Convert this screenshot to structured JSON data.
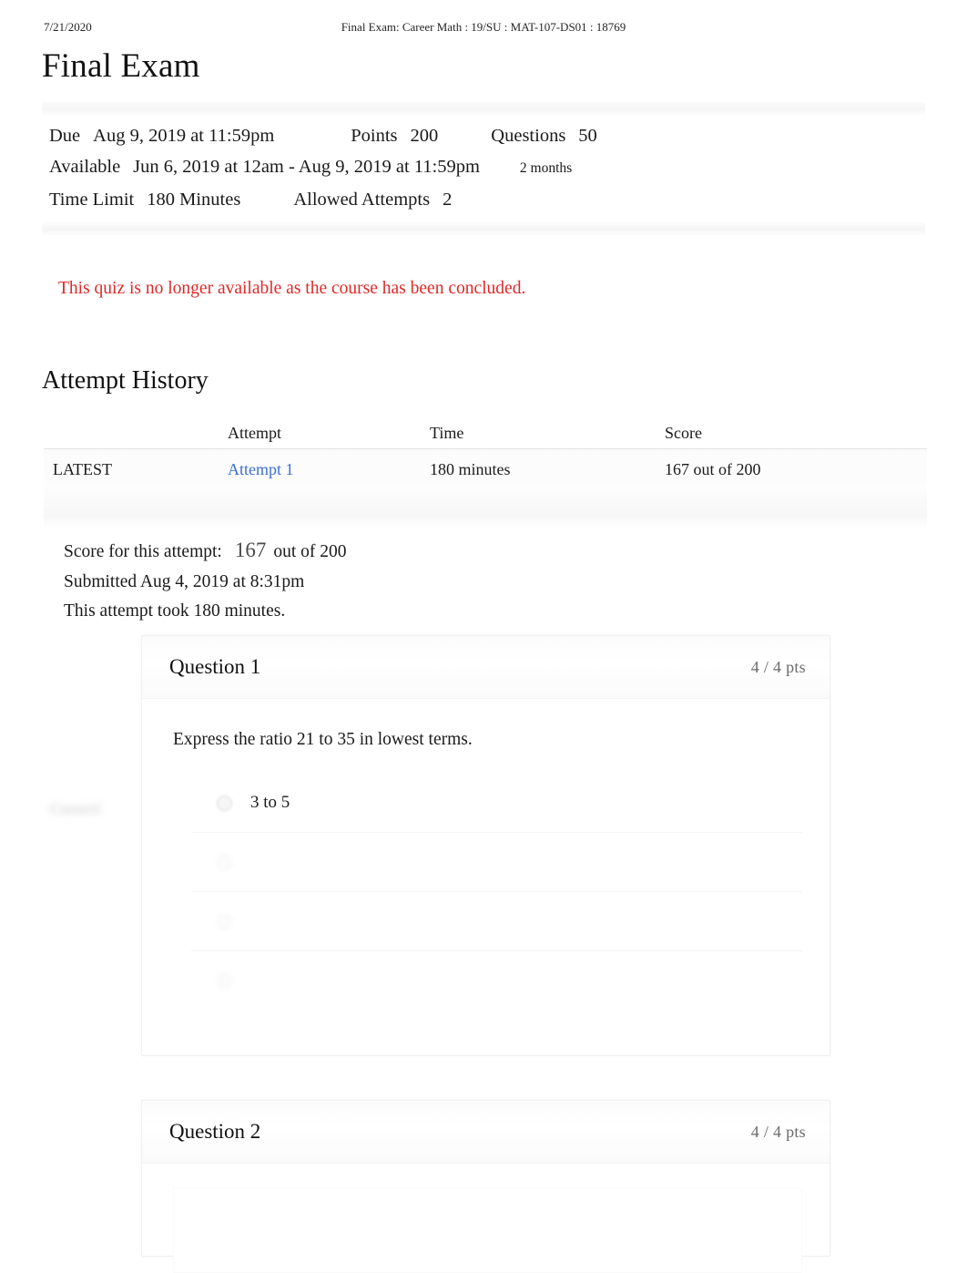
{
  "print_header": {
    "date": "7/21/2020",
    "title": "Final Exam: Career Math : 19/SU : MAT-107-DS01 : 18769"
  },
  "page": {
    "title": "Final Exam"
  },
  "quiz_details": {
    "due_label": "Due",
    "due_value": "Aug 9, 2019 at 11:59pm",
    "points_label": "Points",
    "points_value": "200",
    "questions_label": "Questions",
    "questions_value": "50",
    "available_label": "Available",
    "available_value": "Jun 6, 2019 at 12am - Aug 9, 2019 at 11:59pm",
    "available_duration": "2 months",
    "time_limit_label": "Time Limit",
    "time_limit_value": "180 Minutes",
    "allowed_attempts_label": "Allowed Attempts",
    "allowed_attempts_value": "2"
  },
  "notice": {
    "text": "This quiz is no longer available as the course has been concluded.",
    "color": "#e02828"
  },
  "attempt_history": {
    "heading": "Attempt History",
    "columns": [
      "",
      "Attempt",
      "Time",
      "Score"
    ],
    "rows": [
      {
        "kept": "LATEST",
        "attempt": "Attempt 1",
        "time": "180 minutes",
        "score": "167 out of 200"
      }
    ],
    "link_color": "#3b6fd4"
  },
  "score_summary": {
    "score_label": "Score for this attempt:",
    "score_value": "167",
    "score_out_of": "out of 200",
    "submitted": "Submitted Aug 4, 2019 at 8:31pm",
    "duration": "This attempt took 180 minutes."
  },
  "questions": [
    {
      "name": "Question 1",
      "points": "4 / 4 pts",
      "text": "Express the ratio 21 to 35 in lowest terms.",
      "correct_badge": "Correct!",
      "answers": [
        {
          "text": "3 to 5",
          "faded": false
        },
        {
          "text": "",
          "faded": true
        },
        {
          "text": "",
          "faded": true
        },
        {
          "text": "",
          "faded": true
        }
      ]
    },
    {
      "name": "Question 2",
      "points": "4 / 4 pts",
      "text": "",
      "answers": []
    }
  ]
}
